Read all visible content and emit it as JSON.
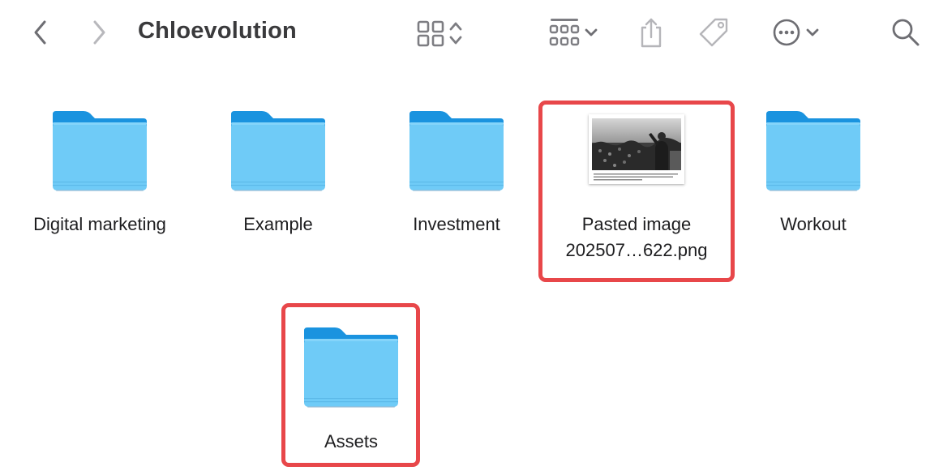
{
  "window": {
    "title": "Chloevolution"
  },
  "toolbar": {
    "back_icon": "chevron-left-icon",
    "forward_icon": "chevron-right-icon",
    "view_icon": "grid-view-icon",
    "group_icon": "group-by-icon",
    "share_icon": "share-icon",
    "tag_icon": "tag-icon",
    "more_icon": "ellipsis-circle-icon",
    "search_icon": "search-icon"
  },
  "items": [
    {
      "name": "Digital marketing",
      "kind": "folder"
    },
    {
      "name": "Example",
      "kind": "folder"
    },
    {
      "name": "Investment",
      "kind": "folder"
    },
    {
      "name_line1": "Pasted image",
      "name_line2": "202507…622.png",
      "kind": "image"
    },
    {
      "name": "Workout",
      "kind": "folder"
    },
    {
      "name": "Assets",
      "kind": "folder"
    }
  ],
  "colors": {
    "folder_back": "#1a93df",
    "folder_front": "#6fcbf7",
    "highlight": "#e8474a",
    "toolbar_icon": "#7d7d82"
  }
}
